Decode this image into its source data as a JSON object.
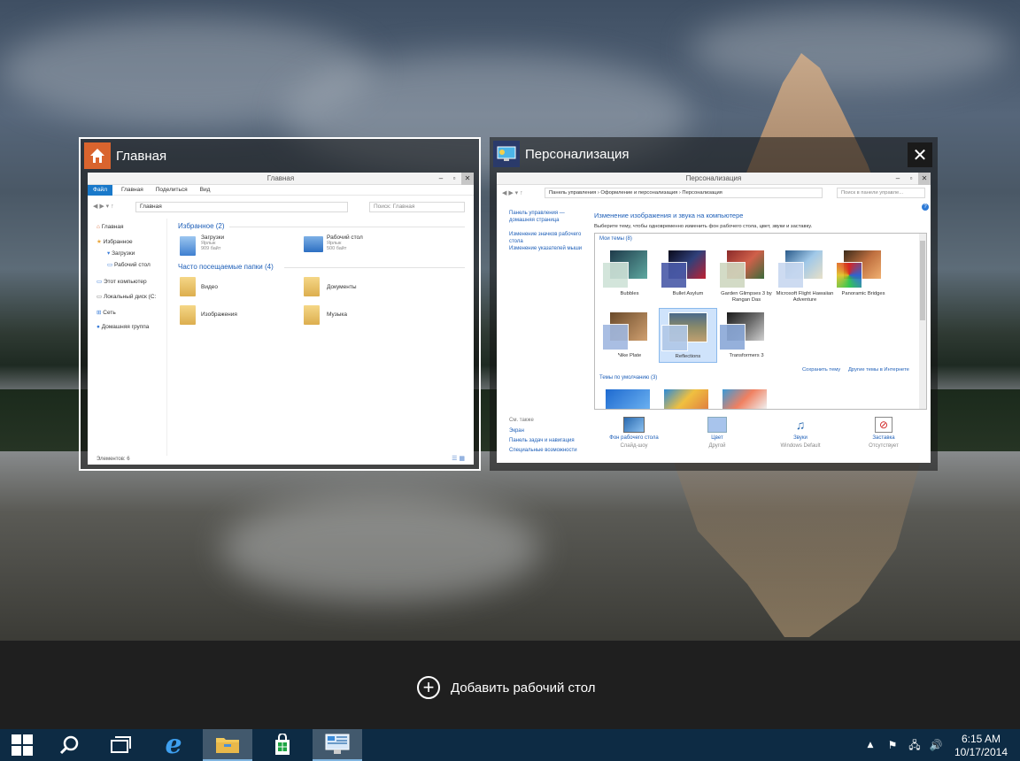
{
  "task_view": {
    "add_desktop_label": "Добавить рабочий стол"
  },
  "windows": [
    {
      "title": "Главная",
      "selected": true,
      "app_icon": "home-icon",
      "content": {
        "window_title": "Главная",
        "ribbon_tabs": [
          "Файл",
          "Главная",
          "Поделиться",
          "Вид"
        ],
        "address": "Главная",
        "search_placeholder": "Поиск: Главная",
        "nav_items": [
          "Главная",
          "Избранное",
          "Загрузки",
          "Рабочий стол",
          "Этот компьютер",
          "Локальный диск (C:",
          "Сеть",
          "Домашняя группа"
        ],
        "favorites_header": "Избранное (2)",
        "favorites": [
          {
            "name": "Загрузки",
            "type": "Ярлык",
            "size": "909 байт"
          },
          {
            "name": "Рабочий стол",
            "type": "Ярлык",
            "size": "500 байт"
          }
        ],
        "frequent_header": "Часто посещаемые папки (4)",
        "frequent": [
          "Видео",
          "Документы",
          "Изображения",
          "Музыка"
        ],
        "status": "Элементов: 6"
      }
    },
    {
      "title": "Персонализация",
      "selected": false,
      "app_icon": "personalization-icon",
      "close_glyph": "✕",
      "content": {
        "window_title": "Персонализация",
        "breadcrumb": "Панель управления › Оформление и персонализация › Персонализация",
        "search_placeholder": "Поиск в панели управле...",
        "left_links": [
          "Панель управления — домашняя страница",
          "Изменение значков рабочего стола",
          "Изменение указателей мыши"
        ],
        "heading": "Изменение изображения и звука на компьютере",
        "subheading": "Выберите тему, чтобы одновременно изменить фон рабочего стола, цвет, звуки и заставку.",
        "my_themes_header": "Мои темы (8)",
        "themes": [
          "Bubbles",
          "Bullet Asylum",
          "Garden Glimpses 3 by Rangan Das",
          "Microsoft Flight Hawaiian Adventure",
          "Panoramic Bridges",
          "Nike Plate",
          "Reflections",
          "Transformers 3"
        ],
        "selected_theme": "Reflections",
        "save_theme_link": "Сохранить тему",
        "online_themes_link": "Другие темы в Интернете",
        "default_themes_header": "Темы по умолчанию (3)",
        "see_also_header": "См. также",
        "see_also": [
          "Экран",
          "Панель задач и навигация",
          "Специальные возможности"
        ],
        "bottom_items": [
          {
            "label": "Фон рабочего стола",
            "sub": "Слайд-шоу"
          },
          {
            "label": "Цвет",
            "sub": "Другой"
          },
          {
            "label": "Звуки",
            "sub": "Windows Default"
          },
          {
            "label": "Заставка",
            "sub": "Отсутствует"
          }
        ]
      }
    }
  ],
  "taskbar": {
    "buttons": [
      "start-icon",
      "search-icon",
      "task-view-icon",
      "internet-explorer-icon",
      "file-explorer-icon",
      "store-icon",
      "control-panel-icon"
    ],
    "active": [
      "file-explorer-icon",
      "control-panel-icon"
    ],
    "clock_time": "6:15 AM",
    "clock_date": "10/17/2014"
  },
  "colors": {
    "taskbar": "#0d2b44",
    "bottom_bar": "#1f1f1f",
    "explorer_accent": "#1979ca",
    "link": "#1e5fb8"
  }
}
